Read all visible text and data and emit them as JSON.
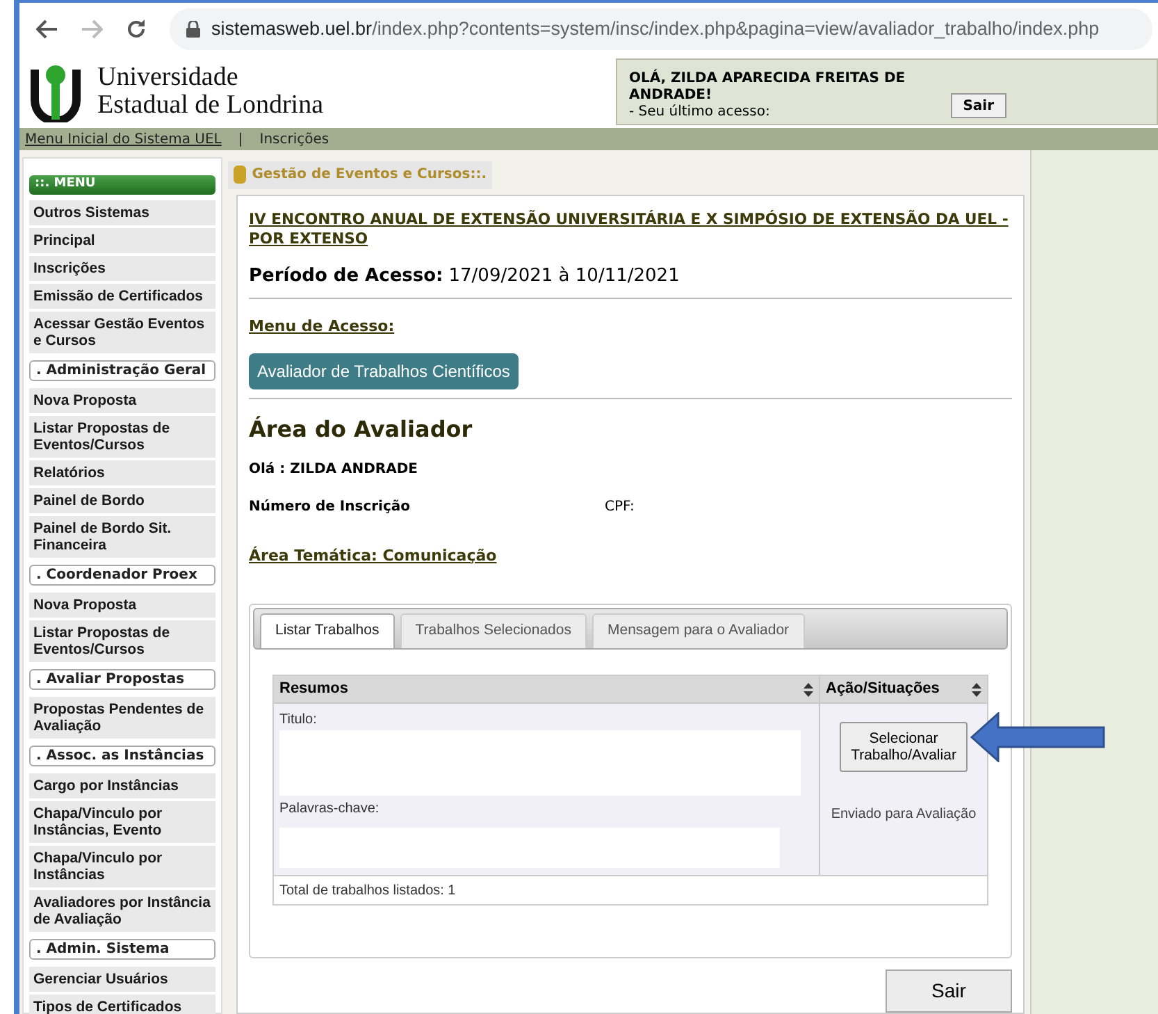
{
  "browser": {
    "url_host": "sistemasweb.uel.br",
    "url_path": "/index.php?contents=system/insc/index.php&pagina=view/avaliador_trabalho/index.php"
  },
  "header": {
    "logo_line1": "Universidade",
    "logo_line2": "Estadual de Londrina",
    "greeting": "OLÁ, ZILDA APARECIDA FREITAS DE ANDRADE!",
    "last_access": "- Seu último acesso:",
    "logout": "Sair"
  },
  "breadcrumb": [
    {
      "label": "Menu Inicial do Sistema UEL",
      "link": true
    },
    {
      "label": "|",
      "link": false
    },
    {
      "label": "Inscrições",
      "link": false
    }
  ],
  "sidebar": [
    {
      "kind": "header",
      "label": "::. MENU"
    },
    {
      "kind": "item",
      "label": "Outros Sistemas"
    },
    {
      "kind": "item",
      "label": "Principal"
    },
    {
      "kind": "item",
      "label": "Inscrições"
    },
    {
      "kind": "item",
      "label": "Emissão de Certificados"
    },
    {
      "kind": "item",
      "label": "Acessar Gestão Eventos e Cursos"
    },
    {
      "kind": "section",
      "label": ". Administração Geral"
    },
    {
      "kind": "item",
      "label": "Nova Proposta"
    },
    {
      "kind": "item",
      "label": "Listar Propostas de Eventos/Cursos"
    },
    {
      "kind": "item",
      "label": "Relatórios"
    },
    {
      "kind": "item",
      "label": "Painel de Bordo"
    },
    {
      "kind": "item",
      "label": "Painel de Bordo Sit. Financeira"
    },
    {
      "kind": "section",
      "label": ". Coordenador Proex"
    },
    {
      "kind": "item",
      "label": "Nova Proposta"
    },
    {
      "kind": "item",
      "label": "Listar Propostas de Eventos/Cursos"
    },
    {
      "kind": "section",
      "label": ". Avaliar Propostas"
    },
    {
      "kind": "item",
      "label": "Propostas Pendentes de Avaliação"
    },
    {
      "kind": "section",
      "label": ". Assoc. as Instâncias"
    },
    {
      "kind": "item",
      "label": "Cargo por Instâncias"
    },
    {
      "kind": "item",
      "label": "Chapa/Vinculo por Instâncias, Evento"
    },
    {
      "kind": "item",
      "label": "Chapa/Vinculo por Instâncias"
    },
    {
      "kind": "item",
      "label": "Avaliadores por Instância de Avaliação"
    },
    {
      "kind": "section",
      "label": ". Admin. Sistema"
    },
    {
      "kind": "item",
      "label": "Gerenciar Usuários"
    },
    {
      "kind": "item",
      "label": "Tipos de Certificados"
    }
  ],
  "panel_title": "Gestão de Eventos e Cursos::.",
  "event_title": "IV ENCONTRO ANUAL DE EXTENSÃO UNIVERSITÁRIA E X SIMPÓSIO DE EXTENSÃO DA UEL - POR EXTENSO",
  "access_period": {
    "label": "Período de Acesso:",
    "value": "17/09/2021 à 10/11/2021"
  },
  "access_menu": {
    "label": "Menu de Acesso:",
    "button": "Avaliador de Trabalhos Científicos"
  },
  "evaluator": {
    "heading": "Área do Avaliador",
    "hello": "Olá : ZILDA ANDRADE",
    "registration": "Número de Inscrição",
    "cpf": "CPF:",
    "area": "Área Temática: Comunicação"
  },
  "tabs": [
    {
      "label": "Listar Trabalhos",
      "selected": true
    },
    {
      "label": "Trabalhos Selecionados",
      "selected": false
    },
    {
      "label": "Mensagem para o Avaliador",
      "selected": false
    }
  ],
  "table": {
    "columns": [
      "Resumos",
      "Ação/Situações"
    ],
    "rows": [
      {
        "title_label": "Titulo:",
        "keywords_label": "Palavras-chave:",
        "action": "Selecionar Trabalho/Avaliar",
        "status": "Enviado para Avaliação"
      }
    ],
    "footer": "Total de trabalhos listados: 1"
  },
  "exit_button": "Sair"
}
